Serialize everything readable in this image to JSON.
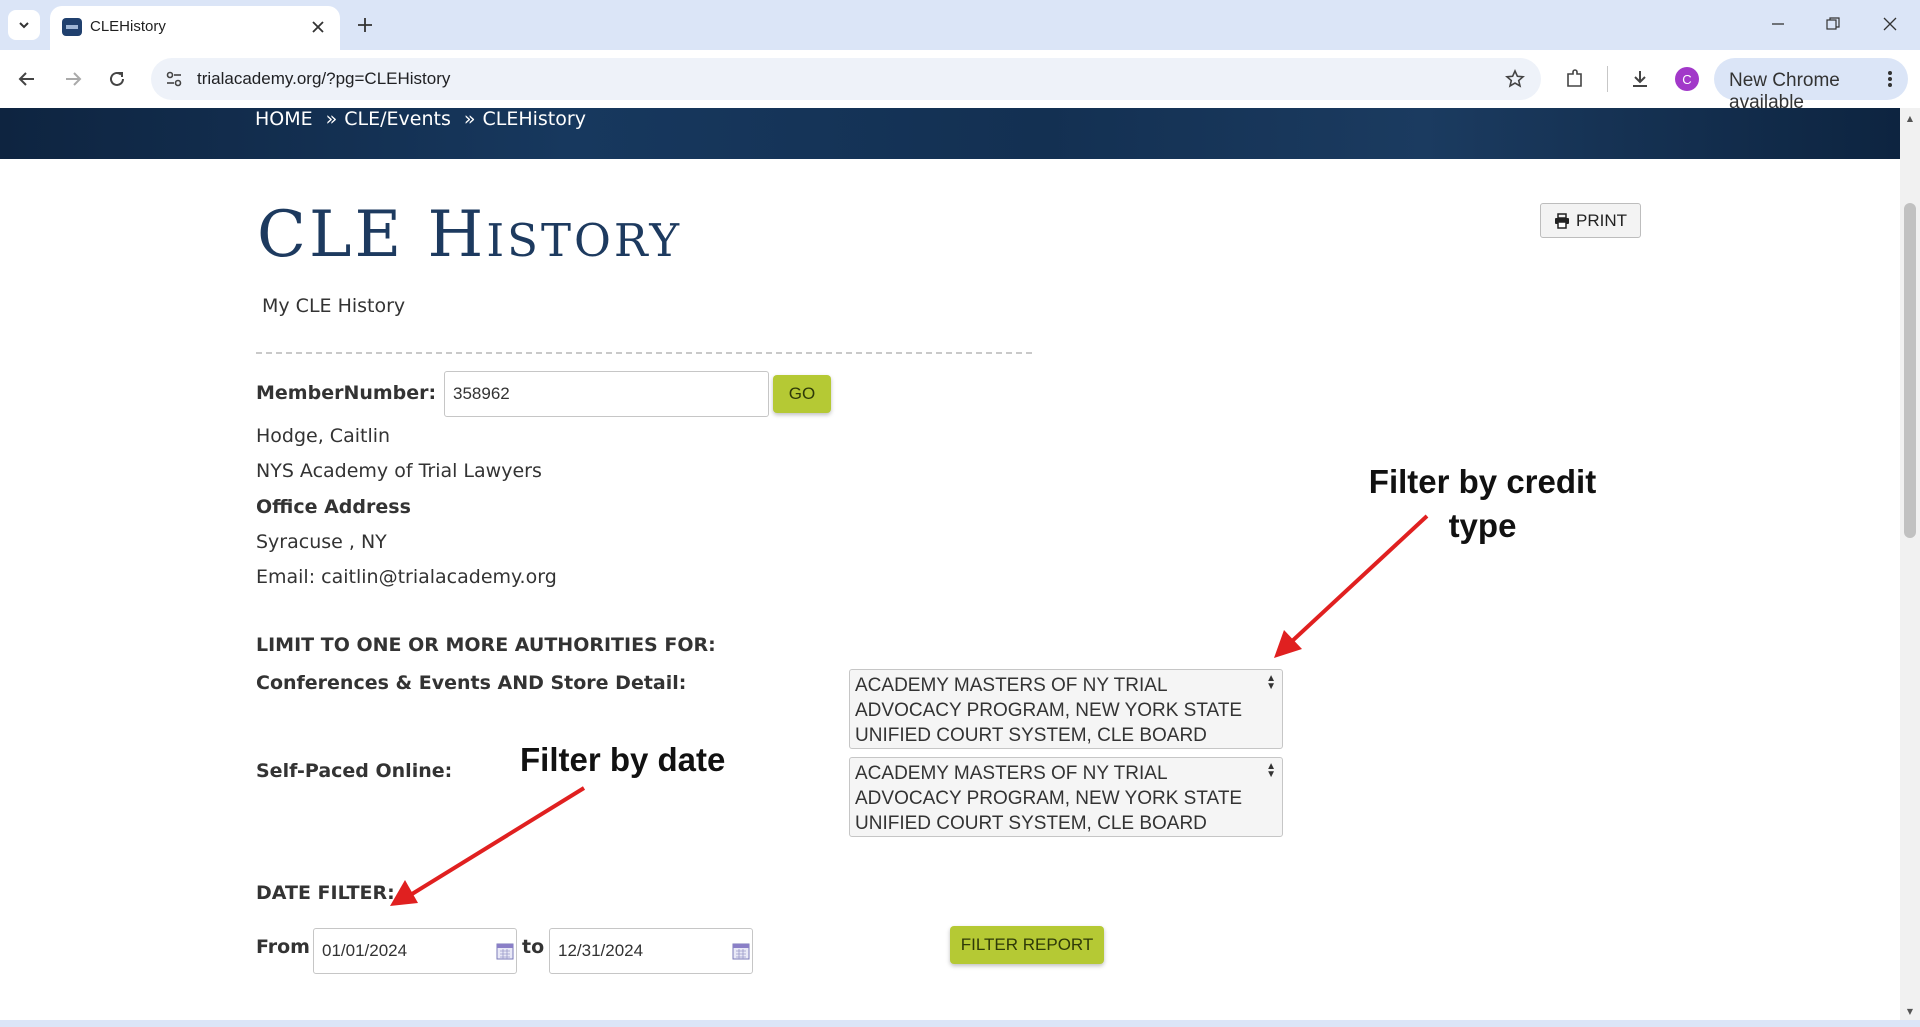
{
  "browser": {
    "tab_title": "CLEHistory",
    "url": "trialacademy.org/?pg=CLEHistory",
    "update_label": "New Chrome available",
    "profile_initial": "C"
  },
  "breadcrumb": {
    "items": [
      "HOME",
      "CLE/Events",
      "CLEHistory"
    ],
    "separator": "»"
  },
  "page": {
    "title": "CLE History",
    "subtitle": "My CLE History",
    "print_label": "PRINT"
  },
  "member": {
    "number_label": "MemberNumber:",
    "number_value": "358962",
    "go_label": "GO",
    "name": "Hodge, Caitlin",
    "organization": "NYS Academy of Trial Lawyers",
    "office_address_label": "Office Address",
    "city_state": "Syracuse , NY",
    "email_line": "Email: caitlin@trialacademy.org"
  },
  "filters": {
    "authorities_heading": "LIMIT TO ONE OR MORE AUTHORITIES FOR:",
    "conferences_label": "Conferences & Events AND Store Detail:",
    "conferences_selected": "ACADEMY MASTERS OF NY TRIAL ADVOCACY PROGRAM, NEW YORK STATE UNIFIED COURT SYSTEM, CLE BOARD",
    "self_paced_label": "Self-Paced Online:",
    "self_paced_selected": "ACADEMY MASTERS OF NY TRIAL ADVOCACY PROGRAM, NEW YORK STATE UNIFIED COURT SYSTEM, CLE BOARD",
    "date_heading": "DATE FILTER:",
    "from_label": "From",
    "from_value": "01/01/2024",
    "to_label": "to",
    "to_value": "12/31/2024",
    "filter_button": "FILTER REPORT"
  },
  "annotations": {
    "credit_type_line1": "Filter by credit",
    "credit_type_line2": "type",
    "date": "Filter by date",
    "arrow_color": "#e02020"
  },
  "colors": {
    "title": "#1d3a5f",
    "button_green": "#b5c934",
    "hero_dark": "#0e2440"
  }
}
